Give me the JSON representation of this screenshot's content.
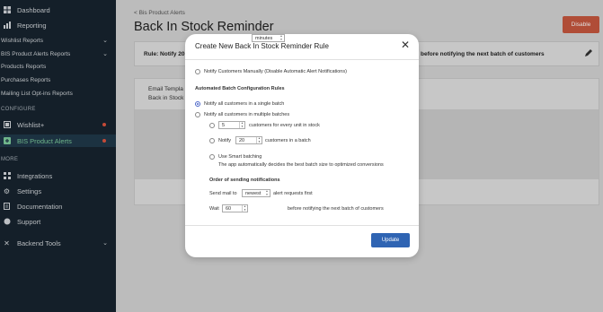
{
  "sidebar": {
    "items": [
      {
        "label": "Dashboard",
        "icon": "dashboard-icon"
      },
      {
        "label": "Reporting",
        "icon": "bar-chart-icon"
      },
      {
        "label": "Wishlist Reports"
      },
      {
        "label": "BIS Product Alerts Reports"
      },
      {
        "label": "Products Reports"
      },
      {
        "label": "Purchases Reports"
      },
      {
        "label": "Mailing List Opt-ins Reports"
      }
    ],
    "configure_heading": "CONFIGURE",
    "configure_items": [
      {
        "label": "Wishlist+",
        "icon": "wishlist-icon"
      },
      {
        "label": "BIS Product Alerts",
        "icon": "bis-icon"
      }
    ],
    "more_heading": "MORE",
    "more_items": [
      {
        "label": "Integrations",
        "icon": "integrations-icon"
      },
      {
        "label": "Settings",
        "icon": "gear-icon"
      },
      {
        "label": "Documentation",
        "icon": "document-icon"
      },
      {
        "label": "Support",
        "icon": "chat-icon"
      }
    ],
    "backend": {
      "label": "Backend Tools",
      "icon": "tools-icon"
    },
    "colors": {
      "bg": "#17242f",
      "active_text": "#7fcf9e",
      "dot": "#e0553f"
    }
  },
  "page": {
    "breadcrumb": "< Bis Product Alerts",
    "title": "Back In Stock Reminder",
    "disable_label": "Disable",
    "rule_left": "Rule: Notify 20",
    "rule_right": "before notifying the next batch of customers",
    "email_title": "Email Templa",
    "email_sub": "Back in Stock"
  },
  "modal": {
    "title": "Create New Back In Stock Reminder Rule",
    "manual_label": "Notify Customers Manually (Disable Automatic Alert Notifications)",
    "batch_heading": "Automated Batch Configuration Rules",
    "single_batch_label": "Notify all customers in a single batch",
    "multi_batch_label": "Notify all customers in multiple batches",
    "per_unit_value": "5",
    "per_unit_label": "customers for every unit in stock",
    "notify_prefix": "Notify",
    "notify_value": "20",
    "notify_suffix": "customers in a batch",
    "smart_label": "Use Smart batching",
    "smart_desc": "The app automatically decides the best batch size to optimized conversions",
    "order_heading": "Order of sending notifications",
    "send_prefix": "Send mail to",
    "send_value": "newest",
    "send_suffix": "alert requests first",
    "wait_prefix": "Wait",
    "wait_value": "60",
    "wait_unit": "minutes",
    "wait_suffix": "before notifying the next batch of customers",
    "update_label": "Update",
    "accent": "#2f64b3"
  }
}
